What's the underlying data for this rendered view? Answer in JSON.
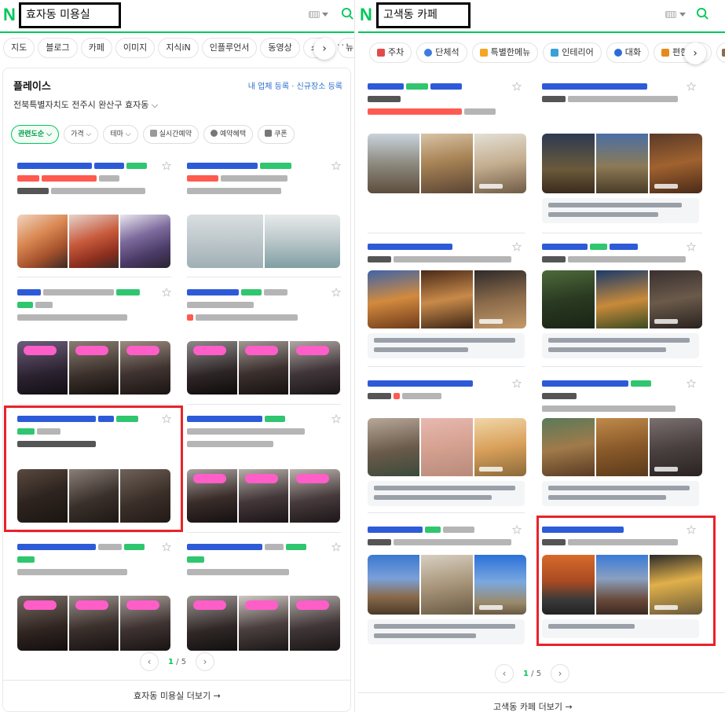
{
  "left": {
    "query": "효자동 미용실",
    "tabs": [
      "지도",
      "블로그",
      "카페",
      "이미지",
      "지식iN",
      "인플루언서",
      "동영상",
      "쇼핑",
      "뉴"
    ],
    "place": {
      "title": "플레이스",
      "links": "내 업체 등록 · 신규장소 등록",
      "location": "전북특별자치도 전주시 완산구 효자동",
      "filters": [
        "관련도순",
        "가격",
        "테마",
        "실시간예약",
        "예약혜택",
        "쿠폰"
      ]
    },
    "pager": {
      "current": "1",
      "total": "5"
    },
    "more_label": "효자동 미용실 더보기"
  },
  "right": {
    "query": "고색동 카페",
    "tabs": [
      "주차",
      "단체석",
      "특별한메뉴",
      "인테리어",
      "대화",
      "편한좌석"
    ],
    "pager": {
      "current": "1",
      "total": "5"
    },
    "more_label": "고색동 카페 더보기"
  },
  "colors": {
    "naver_green": "#03c75a",
    "highlight_red": "#e8232a",
    "tag_pink": "#ff5ec8"
  }
}
